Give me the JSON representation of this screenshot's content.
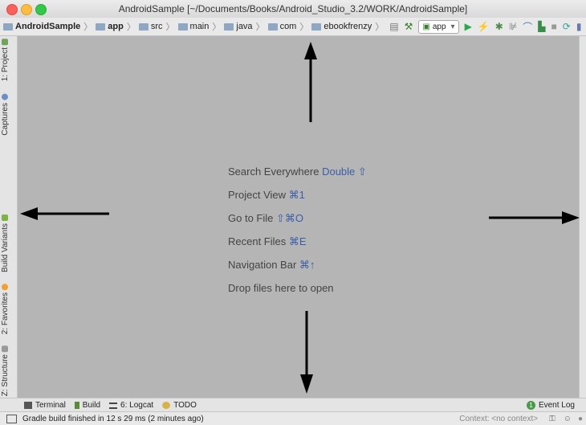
{
  "window": {
    "title": "AndroidSample [~/Documents/Books/Android_Studio_3.2/WORK/AndroidSample]"
  },
  "breadcrumb": [
    "AndroidSample",
    "app",
    "src",
    "main",
    "java",
    "com",
    "ebookfrenzy"
  ],
  "run_config": "app",
  "left_tabs": [
    "1: Project",
    "Captures",
    "Build Variants",
    "2: Favorites",
    "Z: Structure"
  ],
  "hints": {
    "search": {
      "label": "Search Everywhere",
      "key": "Double ⇧"
    },
    "project_view": {
      "label": "Project View",
      "key": "⌘1"
    },
    "go_to_file": {
      "label": "Go to File",
      "key": "⇧⌘O"
    },
    "recent_files": {
      "label": "Recent Files",
      "key": "⌘E"
    },
    "navigation_bar": {
      "label": "Navigation Bar",
      "key": "⌘↑"
    },
    "drop": "Drop files here to open"
  },
  "bottom_tabs": {
    "terminal": "Terminal",
    "build": "Build",
    "logcat": "6: Logcat",
    "todo": "TODO",
    "event_log": "Event Log",
    "event_count": "1"
  },
  "status": {
    "message": "Gradle build finished in 12 s 29 ms (2 minutes ago)",
    "context": "Context: <no context>"
  },
  "colors": {
    "accent_key": "#3a5ea8",
    "editor_bg": "#b5b5b5",
    "run_green": "#2aa84a"
  }
}
